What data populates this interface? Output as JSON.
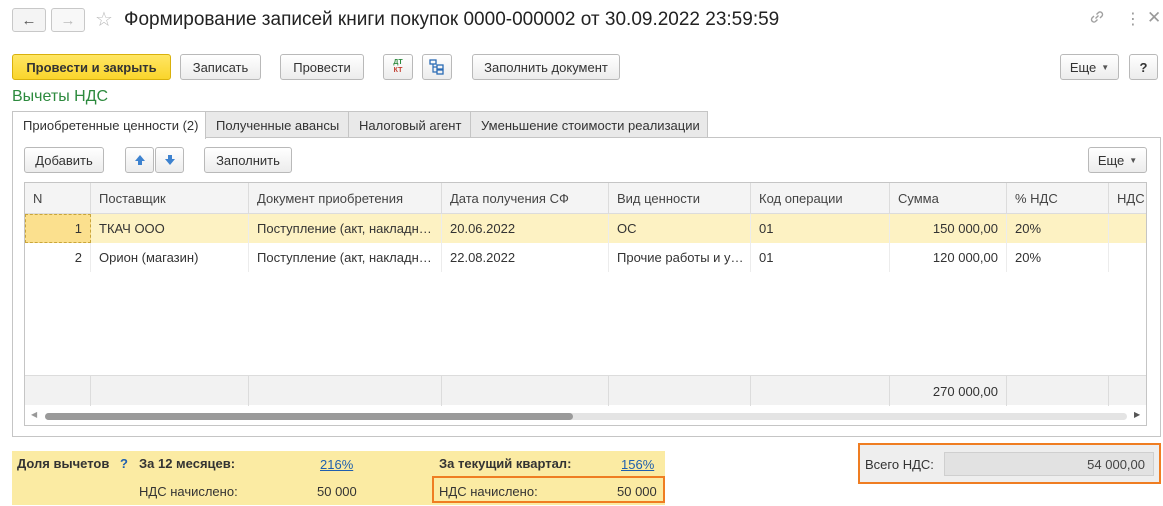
{
  "window": {
    "title": "Формирование записей книги покупок 0000-000002 от 30.09.2022 23:59:59"
  },
  "toolbar": {
    "post_close": "Провести и закрыть",
    "save": "Записать",
    "post": "Провести",
    "dtkt_top": "ДТ",
    "dtkt_bottom": "КТ",
    "fill_doc": "Заполнить документ",
    "more": "Еще",
    "help": "?"
  },
  "section_title": "Вычеты НДС",
  "tabs": [
    {
      "label": "Приобретенные ценности (2)"
    },
    {
      "label": "Полученные авансы"
    },
    {
      "label": "Налоговый агент"
    },
    {
      "label": "Уменьшение стоимости реализации"
    }
  ],
  "table_toolbar": {
    "add": "Добавить",
    "fill": "Заполнить",
    "more": "Еще"
  },
  "table": {
    "columns": [
      "N",
      "Поставщик",
      "Документ приобретения",
      "Дата получения СФ",
      "Вид ценности",
      "Код операции",
      "Сумма",
      "% НДС",
      "НДС"
    ],
    "rows": [
      [
        "1",
        "ТКАЧ ООО",
        "Поступление (акт, накладн…",
        "20.06.2022",
        "ОС",
        "01",
        "150 000,00",
        "20%",
        ""
      ],
      [
        "2",
        "Орион (магазин)",
        "Поступление (акт, накладн…",
        "22.08.2022",
        "Прочие работы и у…",
        "01",
        "120 000,00",
        "20%",
        ""
      ]
    ],
    "footer_sum": "270 000,00"
  },
  "deductions": {
    "share_label": "Доля вычетов",
    "help": "?",
    "months12_label": "За 12 месяцев:",
    "months12_value": "216%",
    "quarter_label": "За текущий квартал:",
    "quarter_value": "156%",
    "vat_charged_label": "НДС начислено:",
    "vat_charged_12": "50 000",
    "vat_charged_quarter": "50 000"
  },
  "total": {
    "label": "Всего НДС:",
    "value": "54 000,00"
  },
  "colors": {
    "primary_button": "#fad52b",
    "section_title": "#2d8a3e",
    "highlight_border": "#ef7d22",
    "selected_row": "#fdf2c3",
    "link": "#1f5fae"
  }
}
